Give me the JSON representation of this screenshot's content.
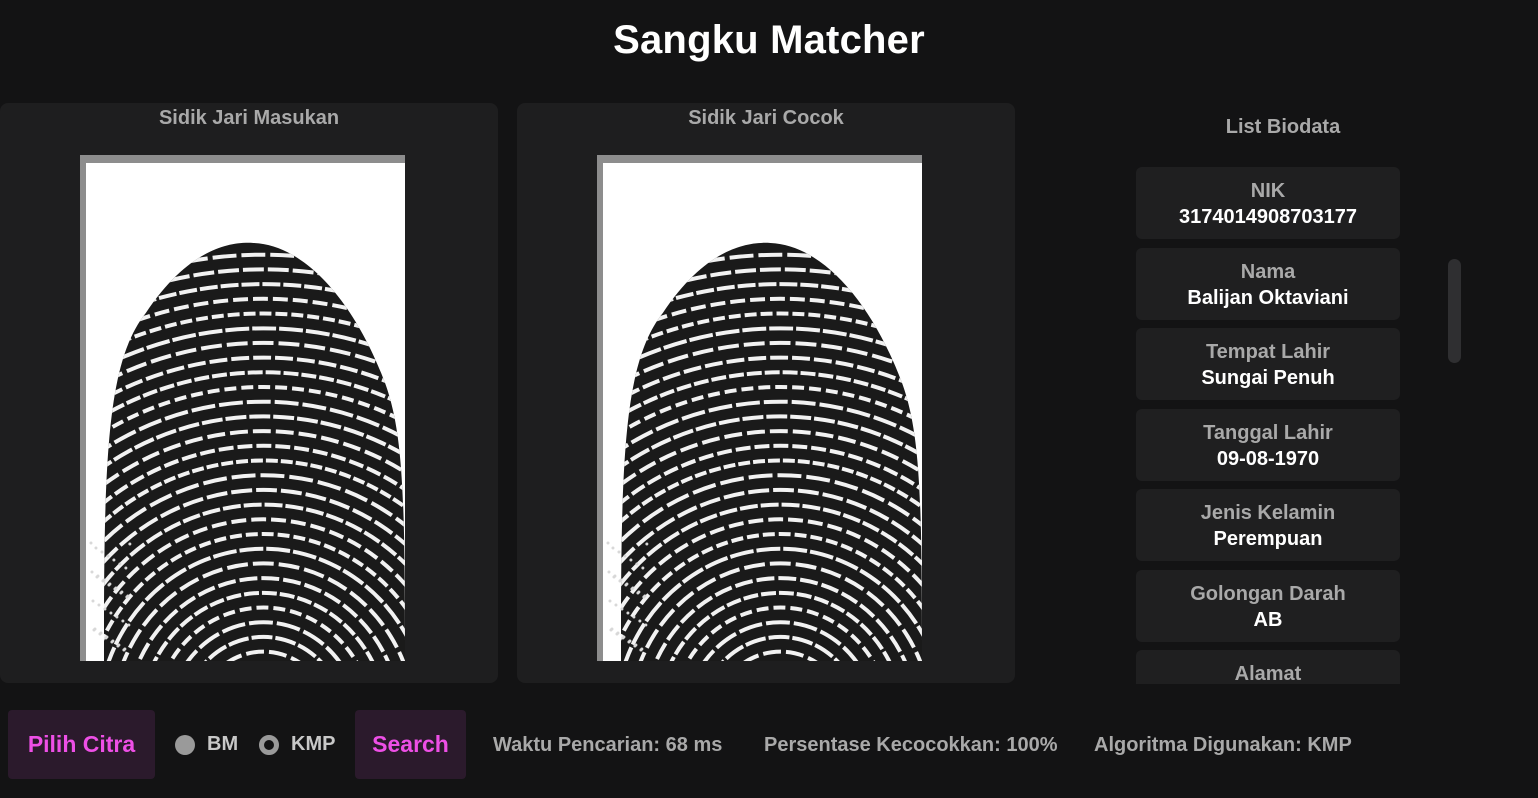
{
  "app": {
    "title": "Sangku Matcher"
  },
  "panels": {
    "input_title": "Sidik Jari Masukan",
    "match_title": "Sidik Jari Cocok"
  },
  "biodata": {
    "header": "List Biodata",
    "items": [
      {
        "label": "NIK",
        "value": "3174014908703177"
      },
      {
        "label": "Nama",
        "value": "Balijan Oktaviani"
      },
      {
        "label": "Tempat Lahir",
        "value": "Sungai Penuh"
      },
      {
        "label": "Tanggal Lahir",
        "value": "09-08-1970"
      },
      {
        "label": "Jenis Kelamin",
        "value": "Perempuan"
      },
      {
        "label": "Golongan Darah",
        "value": "AB"
      },
      {
        "label": "Alamat",
        "value": ""
      }
    ]
  },
  "controls": {
    "pilih_label": "Pilih Citra",
    "search_label": "Search",
    "radio_bm": "BM",
    "radio_kmp": "KMP",
    "selected_algorithm": "KMP"
  },
  "status": {
    "time": "Waktu Pencarian: 68 ms",
    "percent": "Persentase Kecocokkan: 100%",
    "algorithm": "Algoritma Digunakan: KMP"
  },
  "colors": {
    "accent": "#ee4fe6",
    "button_bg": "#2b1a2c",
    "panel_bg": "#1e1e1f",
    "page_bg": "#131314"
  }
}
